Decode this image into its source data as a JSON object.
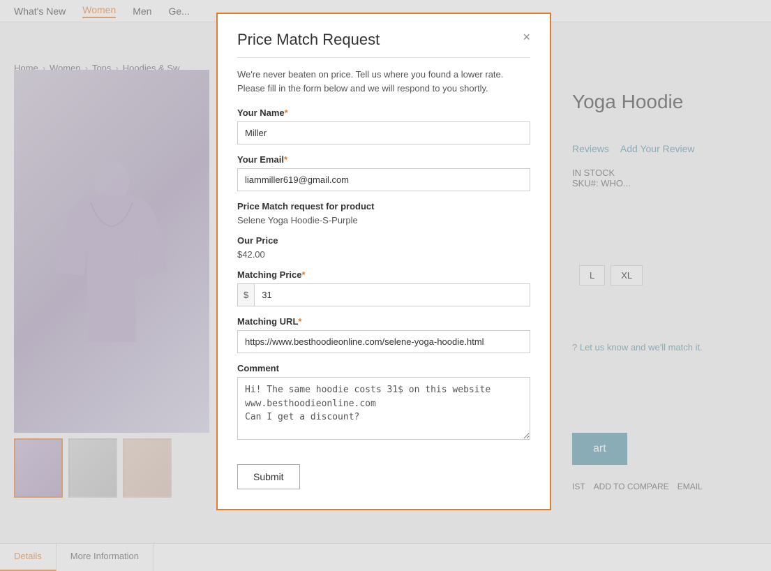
{
  "nav": {
    "items": [
      {
        "label": "What's New",
        "active": false
      },
      {
        "label": "Women",
        "active": true
      },
      {
        "label": "Men",
        "active": false
      },
      {
        "label": "Ge...",
        "active": false
      }
    ]
  },
  "breadcrumb": {
    "items": [
      "Home",
      "Women",
      "Tops",
      "Hoodies & Sw..."
    ]
  },
  "product": {
    "title": "Yoga Hoodie",
    "stock": "IN STOCK",
    "sku_label": "SKU#:",
    "sku_value": "WHO...",
    "sizes": [
      "L",
      "XL"
    ]
  },
  "reviews": {
    "link_label": "Reviews",
    "add_label": "Add Your Review"
  },
  "modal": {
    "title": "Price Match Request",
    "close_icon": "×",
    "description": "We're never beaten on price. Tell us where you found a lower rate. Please fill in the form below and we will respond to you shortly.",
    "name_label": "Your Name",
    "name_value": "Miller",
    "email_label": "Your Email",
    "email_value": "liammiller619@gmail.com",
    "product_label": "Price Match request for product",
    "product_value": "Selene Yoga Hoodie-S-Purple",
    "our_price_label": "Our Price",
    "our_price_value": "$42.00",
    "matching_price_label": "Matching Price",
    "matching_price_currency": "$",
    "matching_price_value": "31",
    "matching_url_label": "Matching URL",
    "matching_url_value": "https://www.besthoodieonline.com/selene-yoga-hoodie.html",
    "comment_label": "Comment",
    "comment_value": "Hi! The same hoodie costs 31$ on this website\nwww.besthoodieonline.com\nCan I get a discount?",
    "submit_label": "Submit"
  },
  "price_match_text": "? Let us know and we'll match it.",
  "cart_label": "art",
  "bottom_actions": [
    "IST",
    "ADD TO COMPARE",
    "EMAIL"
  ],
  "detail_tabs": [
    {
      "label": "Details",
      "active": true
    },
    {
      "label": "More Information",
      "active": false
    }
  ]
}
